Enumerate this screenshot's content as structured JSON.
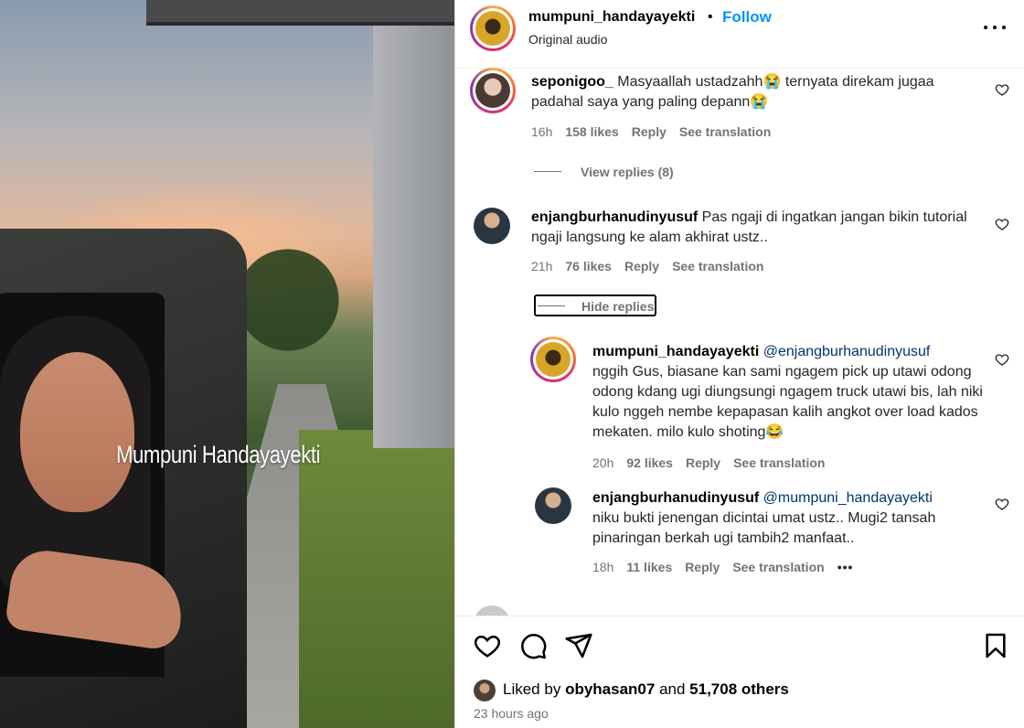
{
  "post": {
    "username": "mumpuni_handayayekti",
    "separator": "•",
    "follow_label": "Follow",
    "audio": "Original audio",
    "watermark": "Mumpuni Handayayekti"
  },
  "comments": [
    {
      "username": "seponigoo_",
      "text": "Masyaallah ustadzahh😭 ternyata direkam jugaa padahal saya yang paling depann😭",
      "time": "16h",
      "likes": "158 likes",
      "reply": "Reply",
      "translate": "See translation",
      "replies_toggle": "View replies (8)"
    },
    {
      "username": "enjangburhanudinyusuf",
      "text": "Pas ngaji di ingatkan jangan bikin tutorial ngaji langsung ke alam akhirat ustz..",
      "time": "21h",
      "likes": "76 likes",
      "reply": "Reply",
      "translate": "See translation",
      "replies_toggle": "Hide replies",
      "replies": [
        {
          "username": "mumpuni_handayayekti",
          "mention": "@enjangburhanudinyusuf",
          "text": "nggih Gus, biasane kan sami ngagem pick up utawi odong odong kdang ugi diungsungi ngagem truck utawi bis, lah niki kulo nggeh nembe kepapasan kalih angkot over load kados mekaten. milo kulo shoting😂",
          "time": "20h",
          "likes": "92 likes",
          "reply": "Reply",
          "translate": "See translation"
        },
        {
          "username": "enjangburhanudinyusuf",
          "mention": "@mumpuni_handayayekti",
          "text": "niku bukti jenengan dicintai umat ustz.. Mugi2 tansah pinaringan berkah ugi tambih2 manfaat..",
          "time": "18h",
          "likes": "11 likes",
          "reply": "Reply",
          "translate": "See translation",
          "more": "•••"
        }
      ]
    }
  ],
  "footer": {
    "liked_prefix": "Liked by",
    "liked_user": "obyhasan07",
    "liked_and": "and",
    "liked_others": "51,708 others",
    "time_ago": "23 hours ago"
  },
  "icons": [
    "heart-icon",
    "comment-icon",
    "share-icon",
    "bookmark-icon",
    "more-icon"
  ],
  "colors": {
    "follow": "#0095f6",
    "mention": "#00376b",
    "muted": "#737373"
  }
}
